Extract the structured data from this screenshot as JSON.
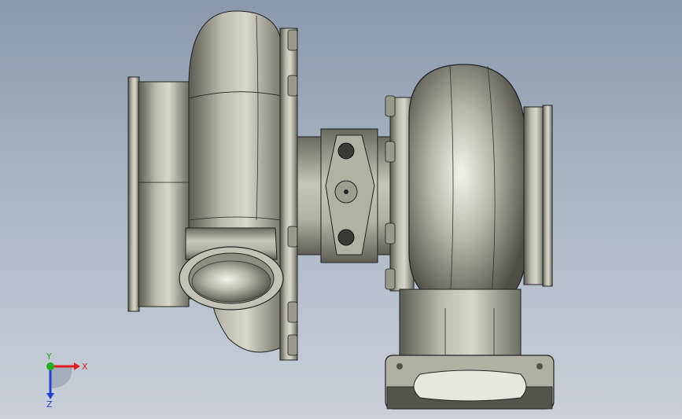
{
  "viewport": {
    "background_top": "#8c99ad",
    "background_bottom": "#c9d0d9",
    "model_color": "#a9a89b"
  },
  "triad": {
    "x_label": "X",
    "y_label": "Y",
    "z_label": "Z",
    "x_color": "#e02020",
    "y_color": "#20b020",
    "z_color": "#2040d0"
  }
}
